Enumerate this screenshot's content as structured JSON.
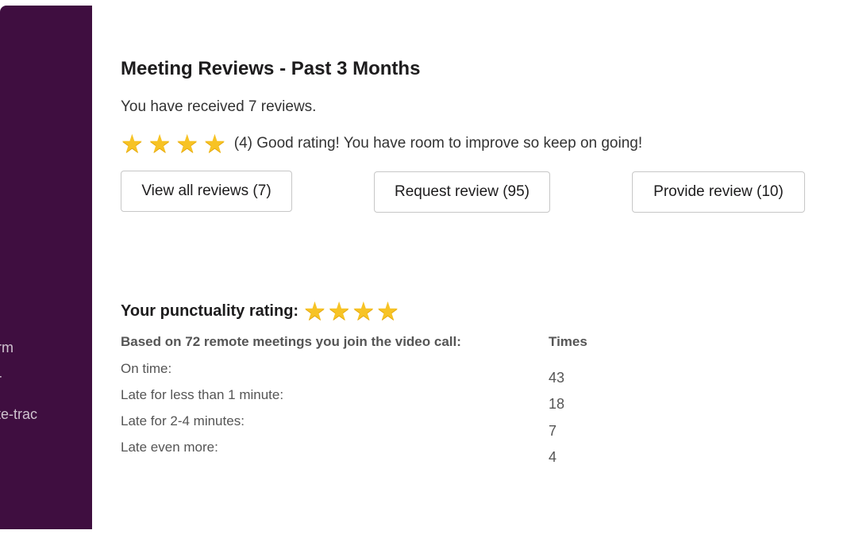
{
  "sidebar": {
    "items": [
      {
        "label": "rm"
      },
      {
        "label": "r"
      },
      {
        "label": "te-trac"
      }
    ],
    "color": "#3f0e40"
  },
  "reviews": {
    "title": "Meeting Reviews - Past 3 Months",
    "received": "You have received 7 reviews.",
    "stars": 4,
    "rating_text": "(4) Good rating! You have room to improve so keep on going!",
    "buttons": {
      "view_all": "View all reviews (7)",
      "request": "Request review (95)",
      "provide": "Provide review (10)"
    }
  },
  "punctuality": {
    "label": "Your punctuality rating:",
    "stars": 4,
    "based_on": "Based on 72 remote meetings you join the video call:",
    "times_header": "Times",
    "rows": [
      {
        "label": "On time:",
        "value": "43"
      },
      {
        "label": "Late for less than 1 minute:",
        "value": "18"
      },
      {
        "label": "Late for 2-4 minutes:",
        "value": "7"
      },
      {
        "label": "Late even more:",
        "value": "4"
      }
    ]
  }
}
